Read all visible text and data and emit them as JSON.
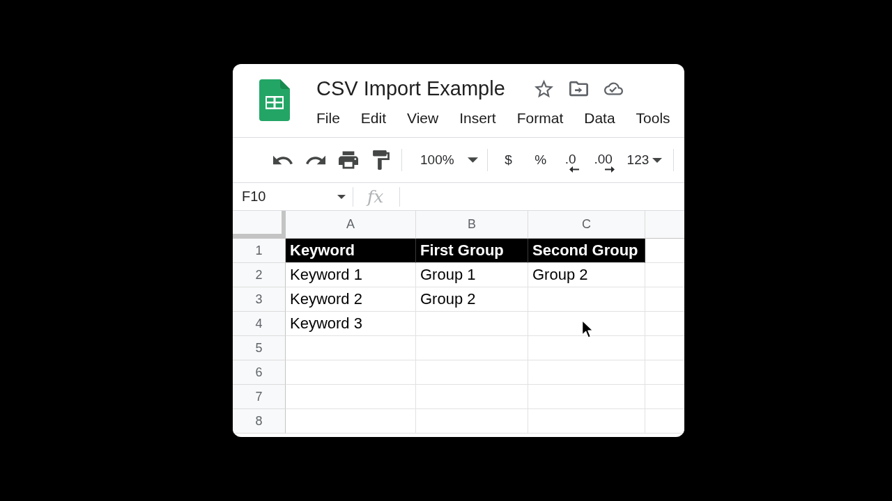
{
  "document": {
    "title": "CSV Import Example"
  },
  "menu": [
    "File",
    "Edit",
    "View",
    "Insert",
    "Format",
    "Data",
    "Tools"
  ],
  "toolbar": {
    "zoom": "100%",
    "format_buttons": [
      {
        "kind": "currency",
        "label": "$"
      },
      {
        "kind": "percent",
        "label": "%"
      },
      {
        "kind": "decrease_decimal",
        "label": ".0"
      },
      {
        "kind": "increase_decimal",
        "label": ".00"
      },
      {
        "kind": "more_formats",
        "label": "123"
      }
    ]
  },
  "formula_bar": {
    "name_box": "F10",
    "formula_label": "fx"
  },
  "grid": {
    "columns": [
      "A",
      "B",
      "C"
    ],
    "rows": [
      {
        "number": "1",
        "kind": "header",
        "cells": [
          "Keyword",
          "First Group",
          "Second Group"
        ]
      },
      {
        "number": "2",
        "kind": "data",
        "cells": [
          "Keyword 1",
          "Group 1",
          "Group 2"
        ]
      },
      {
        "number": "3",
        "kind": "data",
        "cells": [
          "Keyword 2",
          "Group 2"
        ]
      },
      {
        "number": "4",
        "kind": "data",
        "cells": [
          "Keyword 3"
        ]
      },
      {
        "number": "5",
        "kind": "data"
      },
      {
        "number": "6",
        "kind": "data"
      },
      {
        "number": "7",
        "kind": "data"
      },
      {
        "number": "8",
        "kind": "data"
      }
    ]
  }
}
